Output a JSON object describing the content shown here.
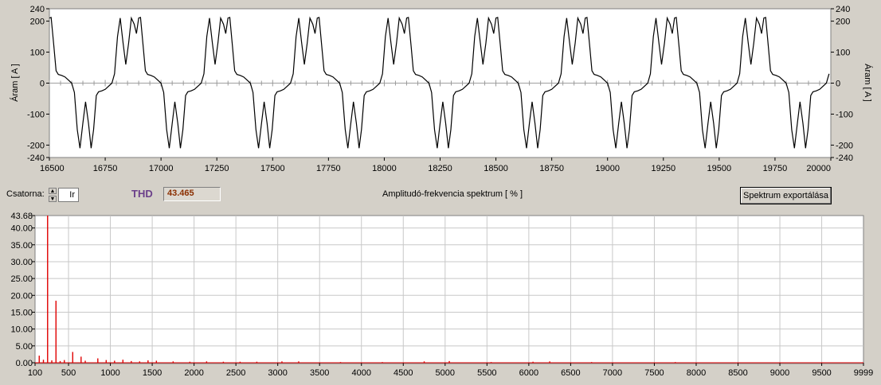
{
  "controls": {
    "channel_label": "Csatorna:",
    "channel_value": "Ir",
    "thd_label": "THD",
    "thd_value": "43.465",
    "spectrum_title": "Amplitudó-frekvencia spektrum [ % ]",
    "export_button": "Spektrum exportálása"
  },
  "colors": {
    "background": "#d4d0c8",
    "plot_bg": "#ffffff",
    "grid": "#c0c0c0",
    "waveform": "#000000",
    "spectrum": "#e00000",
    "thd_label": "#6b3f8a",
    "thd_value": "#8b2f00"
  },
  "chart_data": [
    {
      "type": "line",
      "ylabel_left": "Áram [ A ]",
      "ylabel_right": "Áram [ A ]",
      "xlim": [
        16500,
        20000
      ],
      "ylim": [
        -240,
        240
      ],
      "x_ticks": [
        "16500",
        "16750",
        "17000",
        "17250",
        "17500",
        "17750",
        "18000",
        "18250",
        "18500",
        "18750",
        "19000",
        "19250",
        "19500",
        "19750",
        "20000"
      ],
      "y_ticks_left": [
        "240",
        "200",
        "100",
        "0",
        "-100",
        "-200",
        "-240"
      ],
      "y_ticks_right": [
        "240",
        "200",
        "100",
        "0",
        "-100",
        "-200",
        "-240"
      ],
      "grid": false,
      "period": 400,
      "first_peak_x": 16500,
      "series": [
        {
          "phase_points": [
            [
              0,
              210
            ],
            [
              8,
              212
            ],
            [
              20,
              120
            ],
            [
              30,
              40
            ],
            [
              40,
              28
            ],
            [
              55,
              25
            ],
            [
              70,
              20
            ],
            [
              85,
              10
            ],
            [
              100,
              0
            ],
            [
              112,
              -30
            ],
            [
              125,
              -150
            ],
            [
              137,
              -210
            ],
            [
              150,
              -130
            ],
            [
              162,
              -60
            ],
            [
              175,
              -130
            ],
            [
              187,
              -210
            ],
            [
              198,
              -150
            ],
            [
              210,
              -40
            ],
            [
              220,
              -28
            ],
            [
              235,
              -25
            ],
            [
              250,
              -20
            ],
            [
              265,
              -10
            ],
            [
              280,
              0
            ],
            [
              292,
              30
            ],
            [
              305,
              150
            ],
            [
              317,
              210
            ],
            [
              330,
              130
            ],
            [
              342,
              60
            ],
            [
              355,
              130
            ],
            [
              367,
              210
            ],
            [
              380,
              190
            ],
            [
              390,
              160
            ],
            [
              400,
              210
            ]
          ]
        }
      ]
    },
    {
      "type": "bar",
      "xlim": [
        100,
        9999
      ],
      "ylim": [
        0,
        43.68
      ],
      "x_ticks": [
        "100",
        "500",
        "1000",
        "1500",
        "2000",
        "2500",
        "3000",
        "3500",
        "4000",
        "4500",
        "5000",
        "5500",
        "6000",
        "6500",
        "7000",
        "7500",
        "8000",
        "8500",
        "9000",
        "9500",
        "9999"
      ],
      "y_ticks": [
        "43.68",
        "40.00",
        "35.00",
        "30.00",
        "25.00",
        "20.00",
        "15.00",
        "10.00",
        "5.00",
        "0.00"
      ],
      "grid": true,
      "series": [
        {
          "points": [
            [
              150,
              2.1
            ],
            [
              200,
              0.9
            ],
            [
              250,
              43.68
            ],
            [
              300,
              0.7
            ],
            [
              350,
              18.4
            ],
            [
              400,
              0.5
            ],
            [
              450,
              0.8
            ],
            [
              550,
              3.2
            ],
            [
              650,
              1.8
            ],
            [
              700,
              0.6
            ],
            [
              850,
              1.3
            ],
            [
              950,
              0.8
            ],
            [
              1050,
              0.6
            ],
            [
              1150,
              0.9
            ],
            [
              1250,
              0.5
            ],
            [
              1350,
              0.4
            ],
            [
              1450,
              0.7
            ],
            [
              1550,
              0.6
            ],
            [
              1750,
              0.4
            ],
            [
              1950,
              0.3
            ],
            [
              2150,
              0.4
            ],
            [
              2350,
              0.3
            ],
            [
              2550,
              0.3
            ],
            [
              2750,
              0.3
            ],
            [
              3050,
              0.4
            ],
            [
              3250,
              0.4
            ],
            [
              3750,
              0.2
            ],
            [
              4250,
              0.2
            ],
            [
              4750,
              0.4
            ],
            [
              5050,
              0.5
            ],
            [
              5550,
              0.2
            ],
            [
              6050,
              0.3
            ],
            [
              6250,
              0.4
            ],
            [
              6750,
              0.2
            ],
            [
              7750,
              0.2
            ],
            [
              8250,
              0.1
            ],
            [
              9550,
              0.1
            ]
          ]
        }
      ]
    }
  ]
}
